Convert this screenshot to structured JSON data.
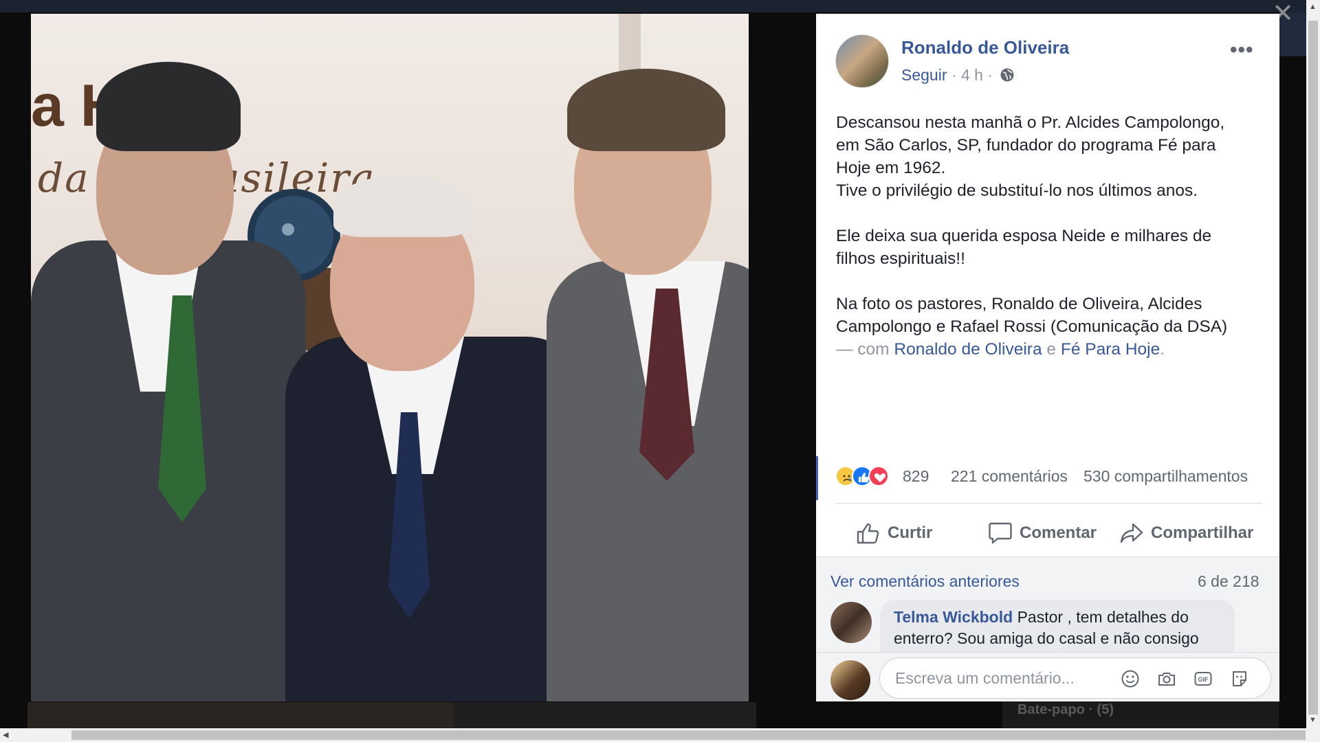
{
  "overlay": {
    "close_icon": "close-icon",
    "chat_bar_label": "Bate-papo · (5)"
  },
  "photo": {
    "wall_text_1": "a H",
    "wall_text_2": "da    ão brasileira...",
    "description_icon": "photo"
  },
  "post": {
    "author": "Ronaldo de Oliveira",
    "follow_label": "Seguir",
    "time": "4 h",
    "separator": "·",
    "privacy_icon": "globe-icon",
    "more_icon": "more-options-icon",
    "text": {
      "p1_l1": "Descansou nesta manhã o Pr. Alcides Campolongo,",
      "p1_l2": "em São Carlos, SP, fundador do programa Fé para",
      "p1_l3": "Hoje em 1962.",
      "p1_l4": "Tive o privilégio de substituí-lo nos últimos anos.",
      "p2_l1": "Ele deixa sua querida esposa Neide e milhares de",
      "p2_l2": "filhos espirituais!!",
      "p3_l1": "Na foto os pastores, Ronaldo de Oliveira, Alcides",
      "p3_l2": "Campolongo e Rafael Rossi (Comunicação da DSA)",
      "with_prefix": "— com",
      "tag1": "Ronaldo de Oliveira",
      "and": "e",
      "tag2": "Fé Para Hoje",
      "end": "."
    },
    "reactions": {
      "count": "829",
      "comments": "221 comentários",
      "shares": "530 compartilhamentos",
      "icons": [
        "sad-reaction-icon",
        "like-reaction-icon",
        "love-reaction-icon"
      ]
    },
    "actions": {
      "like": "Curtir",
      "comment": "Comentar",
      "share": "Compartilhar"
    }
  },
  "comments": {
    "view_previous": "Ver comentários anteriores",
    "pager": "6 de 218",
    "items": [
      {
        "author": "Telma Wickbold",
        "text": "Pastor , tem detalhes do",
        "text_cont": "enterro? Sou amiga do casal e não consigo"
      }
    ],
    "input_placeholder": "Escreva um comentário..."
  },
  "colors": {
    "link": "#385898",
    "secondary": "#90949c",
    "text": "#1d2129",
    "panel_bg": "#ffffff",
    "like_blue": "#1877f2",
    "love_red": "#f33e58",
    "sad_yellow": "#f7c844"
  }
}
